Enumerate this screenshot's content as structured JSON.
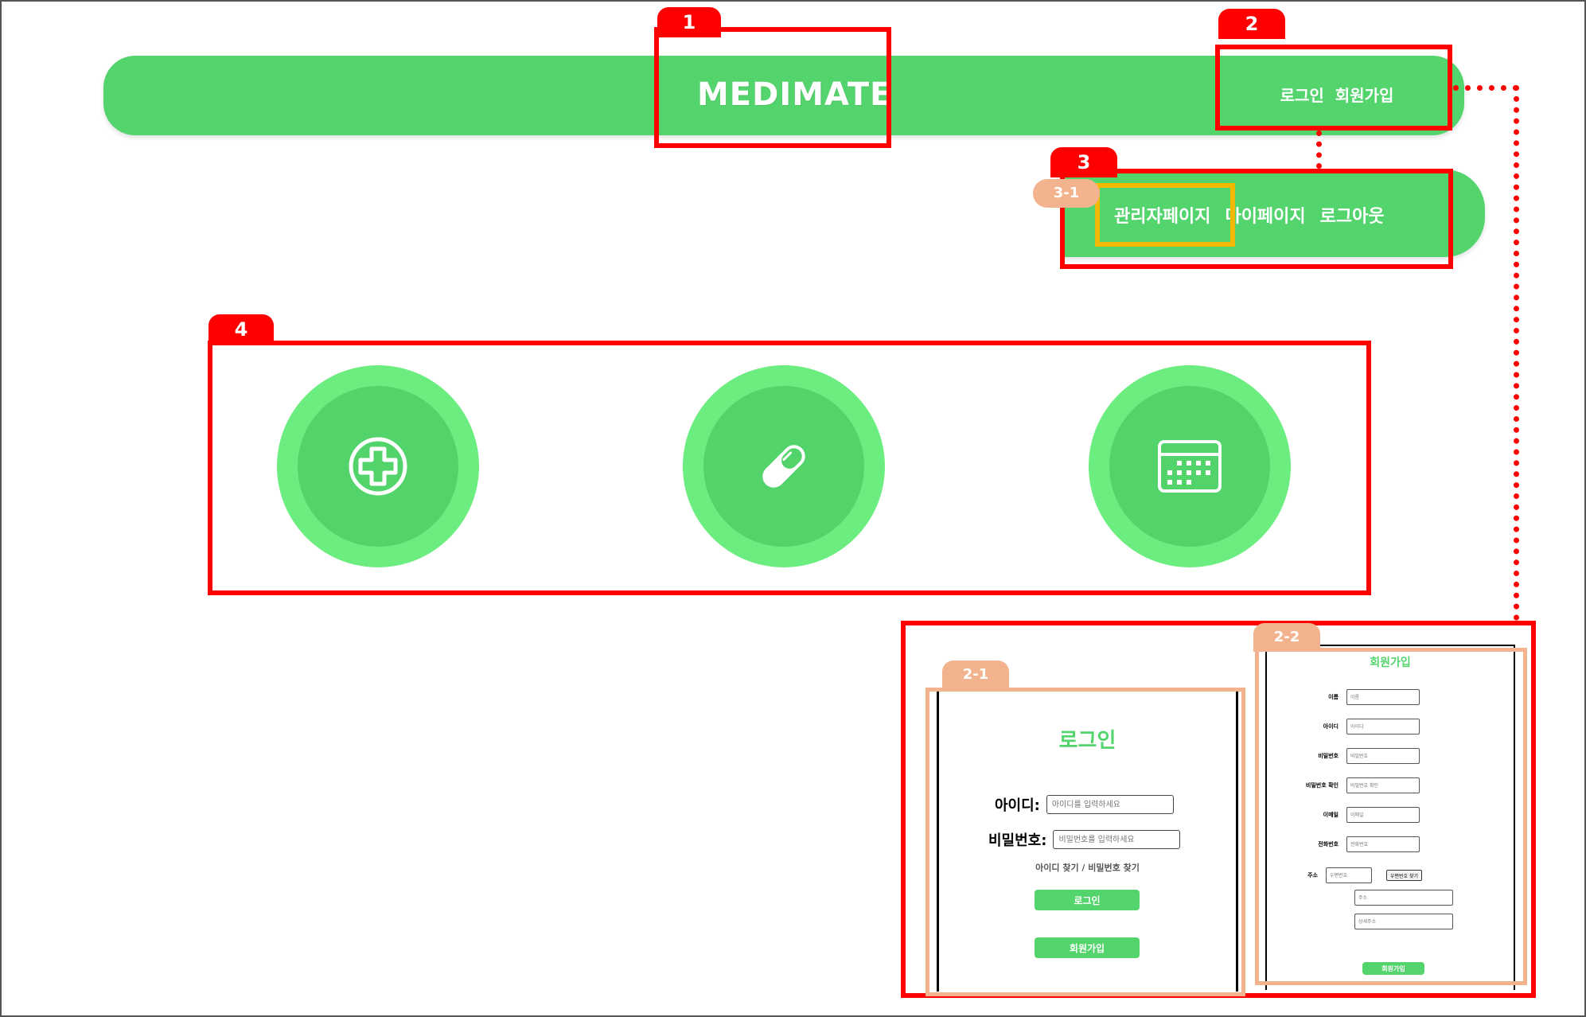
{
  "header": {
    "logo": "MEDIMATE",
    "login": "로그인",
    "signup": "회원가입"
  },
  "submenu": {
    "admin": "관리자페이지",
    "mypage": "마이페이지",
    "logout": "로그아웃"
  },
  "annotations": {
    "a1": "1",
    "a2": "2",
    "a3": "3",
    "a31": "3-1",
    "a4": "4",
    "a21": "2-1",
    "a22": "2-2"
  },
  "features": [
    {
      "icon": "medical-cross-icon"
    },
    {
      "icon": "pill-icon"
    },
    {
      "icon": "calendar-icon"
    }
  ],
  "login_form": {
    "title": "로그인",
    "id_label": "아이디:",
    "id_placeholder": "아이디를 입력하세요",
    "pw_label": "비밀번호:",
    "pw_placeholder": "비밀번호를 입력하세요",
    "find_link": "아이디 찾기 / 비밀번호 찾기",
    "login_button": "로그인",
    "signup_button": "회원가입"
  },
  "signup_form": {
    "title": "회원가입",
    "fields": [
      {
        "label": "이름",
        "placeholder": "이름"
      },
      {
        "label": "아이디",
        "placeholder": "아이디"
      },
      {
        "label": "비밀번호",
        "placeholder": "비밀번호"
      },
      {
        "label": "비밀번호 확인",
        "placeholder": "비밀번호 확인"
      },
      {
        "label": "이메일",
        "placeholder": "이메일"
      },
      {
        "label": "전화번호",
        "placeholder": "전화번호"
      }
    ],
    "address_label": "주소",
    "zip_placeholder": "우편번호",
    "zip_button": "우편번호 찾기",
    "address_placeholder": "주소",
    "detail_placeholder": "상세주소",
    "submit_button": "회원가입"
  },
  "colors": {
    "primary_green": "#53d46c",
    "light_green": "#6ced7f",
    "annotation_red": "#ff0000",
    "annotation_orange": "#f3b38e",
    "annotation_yellow": "#f5b800"
  }
}
